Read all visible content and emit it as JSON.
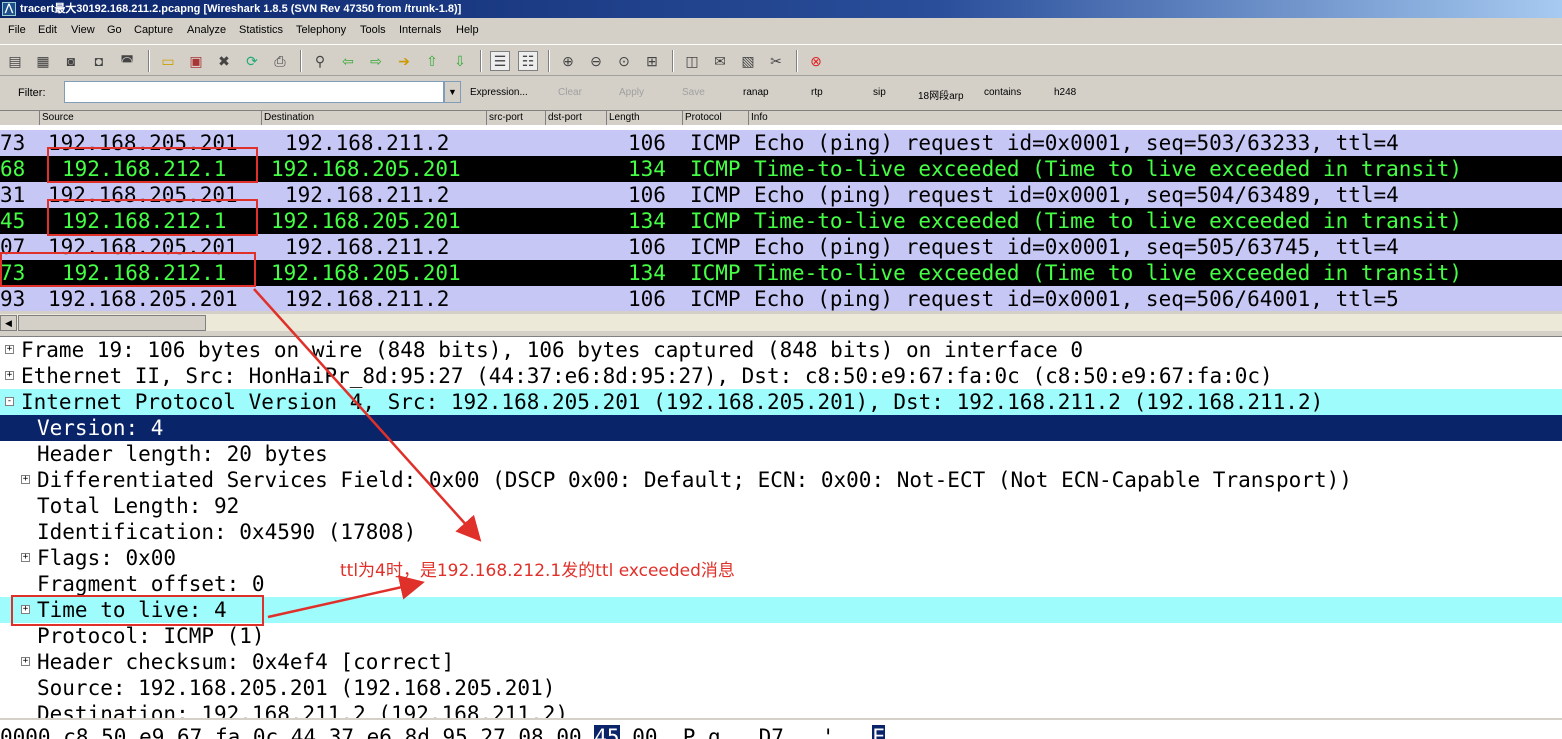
{
  "window": {
    "title": "tracert最大30192.168.211.2.pcapng  [Wireshark 1.8.5  (SVN Rev 47350 from /trunk-1.8)]"
  },
  "menu": [
    {
      "label": "File"
    },
    {
      "label": "Edit"
    },
    {
      "label": "View"
    },
    {
      "label": "Go"
    },
    {
      "label": "Capture"
    },
    {
      "label": "Analyze"
    },
    {
      "label": "Statistics"
    },
    {
      "label": "Telephony"
    },
    {
      "label": "Tools"
    },
    {
      "label": "Internals"
    },
    {
      "label": "Help"
    }
  ],
  "filter": {
    "label": "Filter:",
    "value": "",
    "expression": "Expression...",
    "clear": "Clear",
    "apply": "Apply",
    "save": "Save",
    "shortcuts": [
      "ranap",
      "rtp",
      "sip",
      "18网段arp",
      "contains",
      "h248"
    ]
  },
  "columns": [
    "Source",
    "Destination",
    "src-port",
    "dst-port",
    "Length",
    "Protocol",
    "Info"
  ],
  "packets": [
    {
      "time": "73",
      "src": "192.168.205.201",
      "dst": "192.168.211.2",
      "len": "106",
      "proto": "ICMP",
      "info": "Echo (ping) request  id=0x0001, seq=503/63233, ttl=4",
      "kind": "echo"
    },
    {
      "time": "68",
      "src": "192.168.212.1",
      "dst": "192.168.205.201",
      "len": "134",
      "proto": "ICMP",
      "info": "Time-to-live exceeded (Time to live exceeded in transit)",
      "kind": "ttl"
    },
    {
      "time": "31",
      "src": "192.168.205.201",
      "dst": "192.168.211.2",
      "len": "106",
      "proto": "ICMP",
      "info": "Echo (ping) request  id=0x0001, seq=504/63489, ttl=4",
      "kind": "echo"
    },
    {
      "time": "45",
      "src": "192.168.212.1",
      "dst": "192.168.205.201",
      "len": "134",
      "proto": "ICMP",
      "info": "Time-to-live exceeded (Time to live exceeded in transit)",
      "kind": "ttl"
    },
    {
      "time": "07",
      "src": "192.168.205.201",
      "dst": "192.168.211.2",
      "len": "106",
      "proto": "ICMP",
      "info": "Echo (ping) request  id=0x0001, seq=505/63745, ttl=4",
      "kind": "echo"
    },
    {
      "time": "73",
      "src": "192.168.212.1",
      "dst": "192.168.205.201",
      "len": "134",
      "proto": "ICMP",
      "info": "Time-to-live exceeded (Time to live exceeded in transit)",
      "kind": "ttl"
    },
    {
      "time": "93",
      "src": "192.168.205.201",
      "dst": "192.168.211.2",
      "len": "106",
      "proto": "ICMP",
      "info": "Echo (ping) request  id=0x0001, seq=506/64001, ttl=5",
      "kind": "echo"
    }
  ],
  "details": [
    {
      "text": "Frame 19: 106 bytes on wire (848 bits), 106 bytes captured (848 bits) on interface 0",
      "expander": "+",
      "indent": 0,
      "style": ""
    },
    {
      "text": "Ethernet II, Src: HonHaiPr_8d:95:27 (44:37:e6:8d:95:27), Dst: c8:50:e9:67:fa:0c (c8:50:e9:67:fa:0c)",
      "expander": "+",
      "indent": 0,
      "style": ""
    },
    {
      "text": "Internet Protocol Version 4, Src: 192.168.205.201 (192.168.205.201), Dst: 192.168.211.2 (192.168.211.2)",
      "expander": "-",
      "indent": 0,
      "style": "cyan"
    },
    {
      "text": "Version: 4",
      "expander": "",
      "indent": 1,
      "style": "selected"
    },
    {
      "text": "Header length: 20 bytes",
      "expander": "",
      "indent": 1,
      "style": ""
    },
    {
      "text": "Differentiated Services Field: 0x00 (DSCP 0x00: Default; ECN: 0x00: Not-ECT (Not ECN-Capable Transport))",
      "expander": "+",
      "indent": 1,
      "style": ""
    },
    {
      "text": "Total Length: 92",
      "expander": "",
      "indent": 1,
      "style": ""
    },
    {
      "text": "Identification: 0x4590 (17808)",
      "expander": "",
      "indent": 1,
      "style": ""
    },
    {
      "text": "Flags: 0x00",
      "expander": "+",
      "indent": 1,
      "style": ""
    },
    {
      "text": "Fragment offset: 0",
      "expander": "",
      "indent": 1,
      "style": ""
    },
    {
      "text": "Time to live: 4",
      "expander": "+",
      "indent": 1,
      "style": "cyan"
    },
    {
      "text": "Protocol: ICMP (1)",
      "expander": "",
      "indent": 1,
      "style": ""
    },
    {
      "text": "Header checksum: 0x4ef4 [correct]",
      "expander": "+",
      "indent": 1,
      "style": ""
    },
    {
      "text": "Source: 192.168.205.201 (192.168.205.201)",
      "expander": "",
      "indent": 1,
      "style": ""
    },
    {
      "text": "Destination: 192.168.211.2 (192.168.211.2)",
      "expander": "",
      "indent": 1,
      "style": ""
    }
  ],
  "hex": {
    "offset": "0000",
    "before": "c8 50 e9 67 fa 0c 44 37  e6 8d 95 27 08 00 ",
    "selected": "45",
    "after": " 00  .P.g...D7...'..",
    "ascii_sel": "E"
  },
  "annotation": {
    "text": "ttl为4时，是192.168.212.1发的ttl exceeded消息",
    "color": "#e0302a"
  },
  "colors": {
    "echo_row": "#c7c7f6",
    "ttl_row_bg": "#000000",
    "ttl_row_fg": "#44ff44",
    "selected": "#0a246a",
    "highlight": "#9ffcfc"
  }
}
